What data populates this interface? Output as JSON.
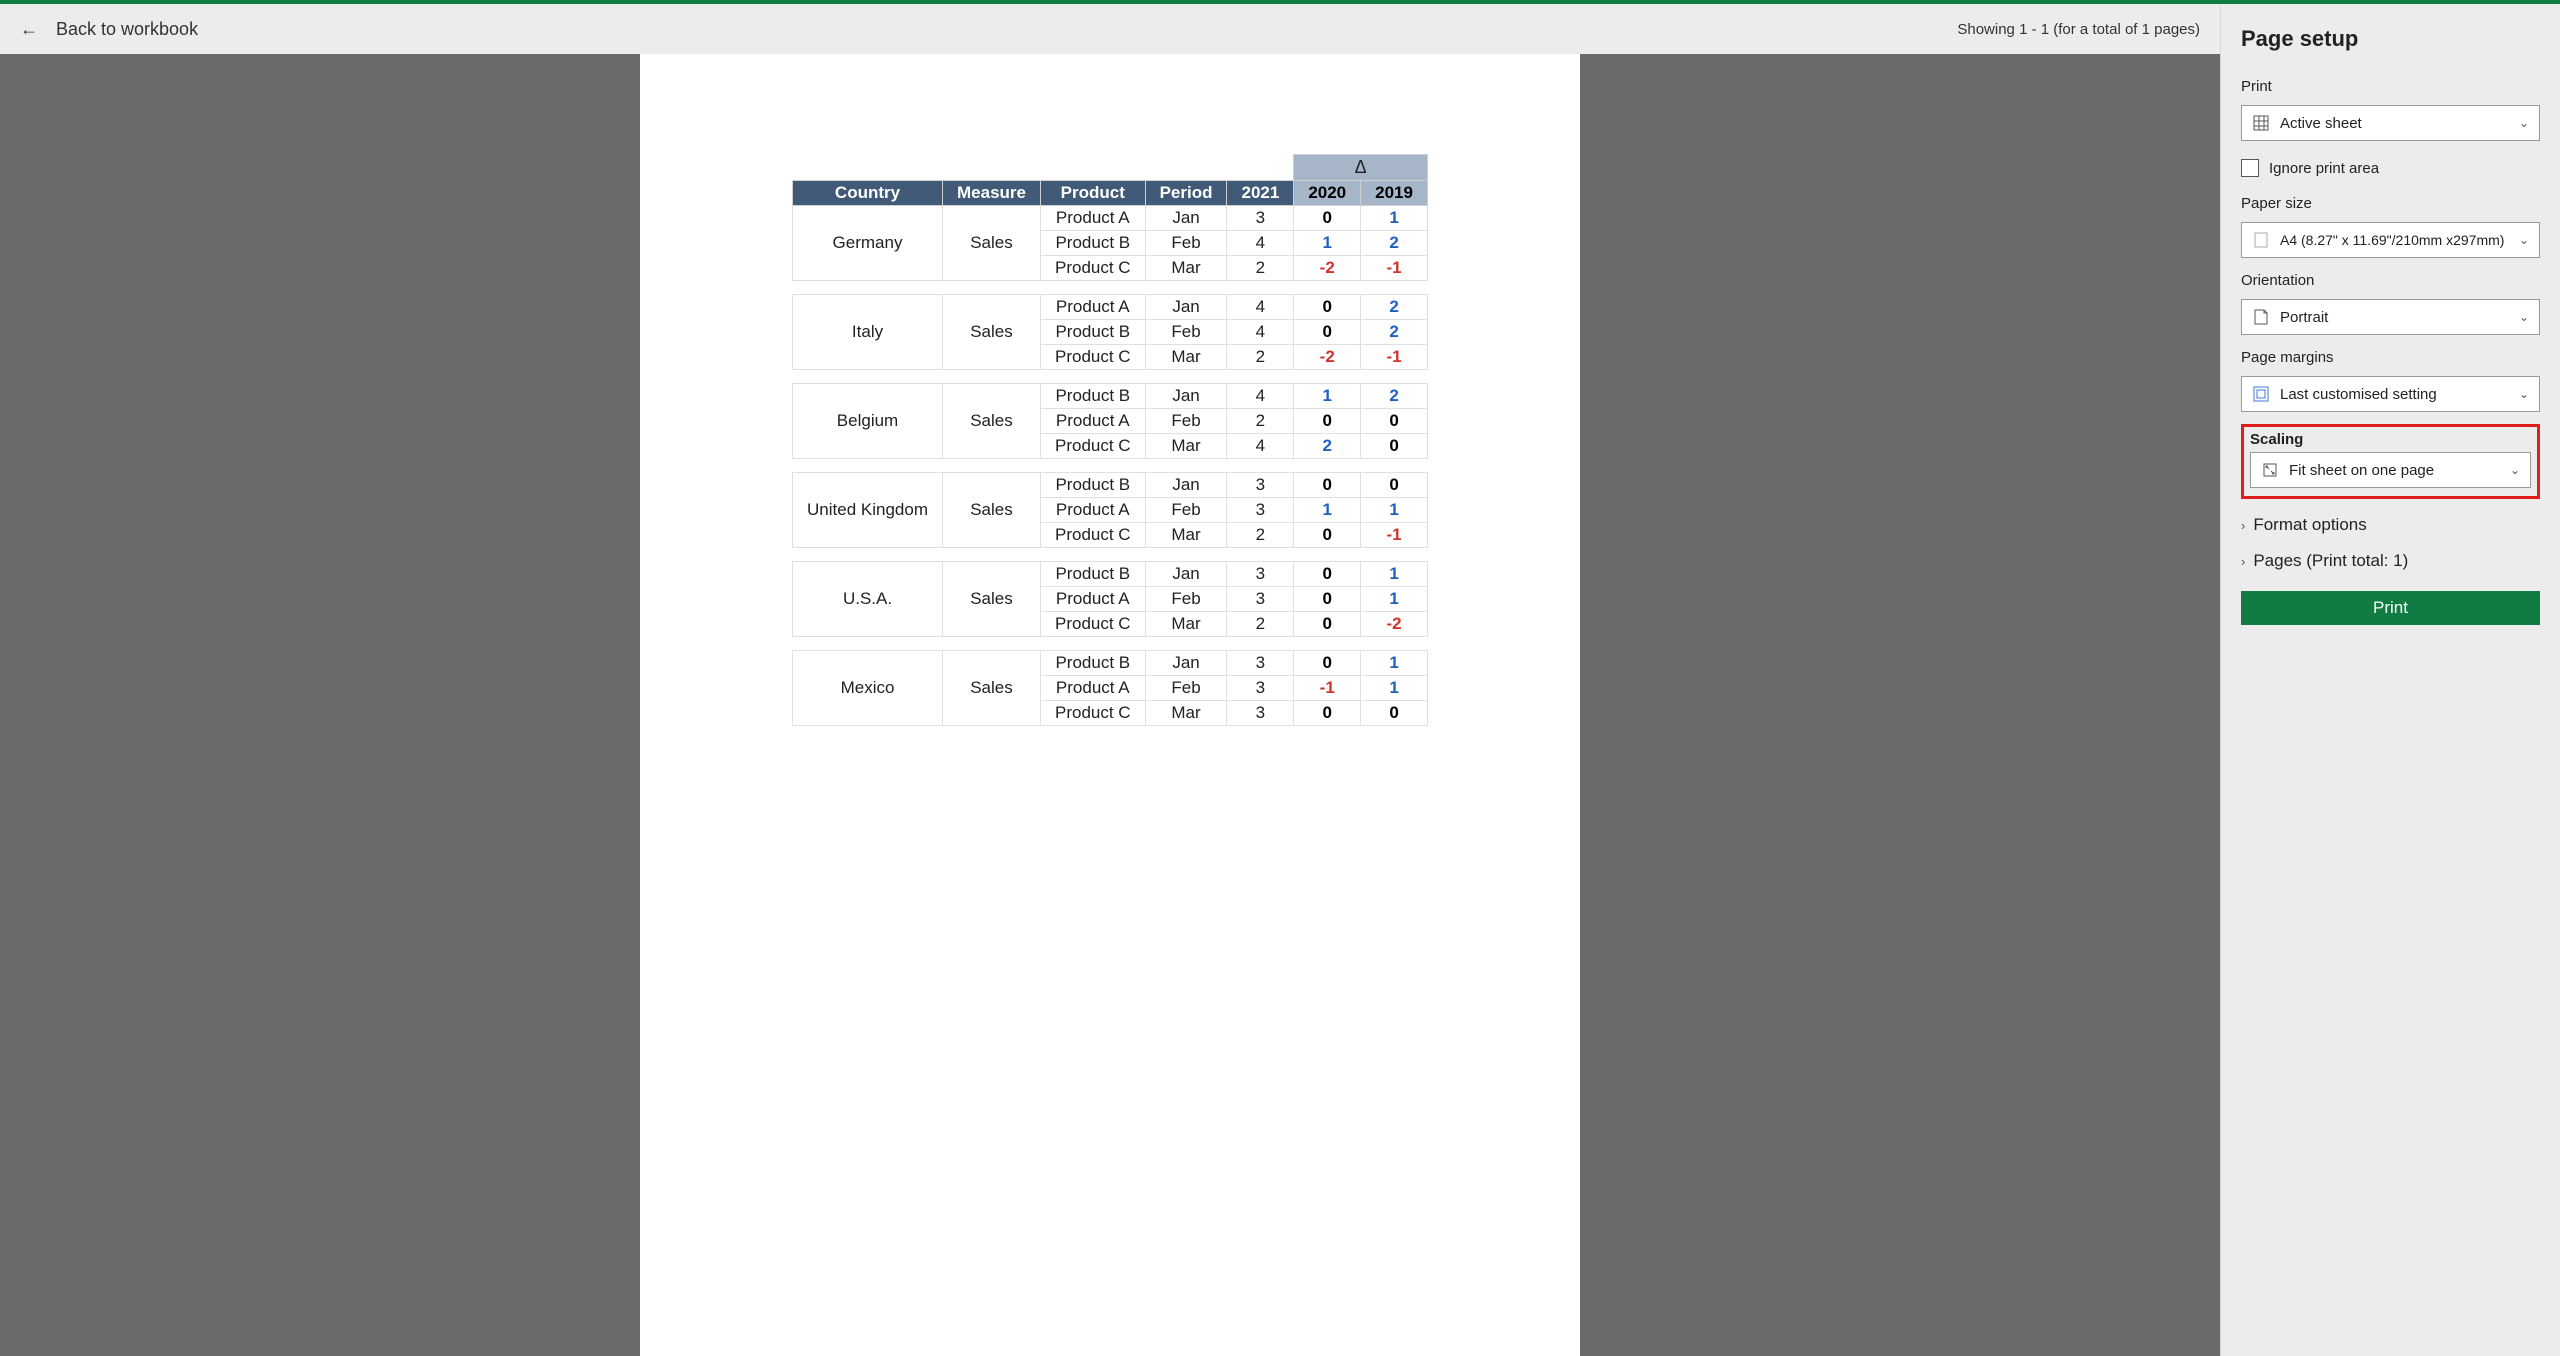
{
  "header": {
    "back_label": "Back to workbook",
    "status": "Showing 1 - 1 (for a total of 1 pages)"
  },
  "table": {
    "columns": [
      "Country",
      "Measure",
      "Product",
      "Period",
      "2021",
      "2020",
      "2019"
    ],
    "delta_symbol": "Δ",
    "groups": [
      {
        "country": "Germany",
        "measure": "Sales",
        "rows": [
          {
            "product": "Product A",
            "period": "Jan",
            "y2021": "3",
            "y2020": "0",
            "y2019": "1",
            "c20": "black",
            "c19": "blue"
          },
          {
            "product": "Product B",
            "period": "Feb",
            "y2021": "4",
            "y2020": "1",
            "y2019": "2",
            "c20": "blue",
            "c19": "blue"
          },
          {
            "product": "Product C",
            "period": "Mar",
            "y2021": "2",
            "y2020": "-2",
            "y2019": "-1",
            "c20": "red",
            "c19": "red"
          }
        ]
      },
      {
        "country": "Italy",
        "measure": "Sales",
        "rows": [
          {
            "product": "Product A",
            "period": "Jan",
            "y2021": "4",
            "y2020": "0",
            "y2019": "2",
            "c20": "black",
            "c19": "blue"
          },
          {
            "product": "Product B",
            "period": "Feb",
            "y2021": "4",
            "y2020": "0",
            "y2019": "2",
            "c20": "black",
            "c19": "blue"
          },
          {
            "product": "Product C",
            "period": "Mar",
            "y2021": "2",
            "y2020": "-2",
            "y2019": "-1",
            "c20": "red",
            "c19": "red"
          }
        ]
      },
      {
        "country": "Belgium",
        "measure": "Sales",
        "rows": [
          {
            "product": "Product B",
            "period": "Jan",
            "y2021": "4",
            "y2020": "1",
            "y2019": "2",
            "c20": "blue",
            "c19": "blue"
          },
          {
            "product": "Product A",
            "period": "Feb",
            "y2021": "2",
            "y2020": "0",
            "y2019": "0",
            "c20": "black",
            "c19": "black"
          },
          {
            "product": "Product C",
            "period": "Mar",
            "y2021": "4",
            "y2020": "2",
            "y2019": "0",
            "c20": "blue",
            "c19": "black"
          }
        ]
      },
      {
        "country": "United Kingdom",
        "measure": "Sales",
        "rows": [
          {
            "product": "Product B",
            "period": "Jan",
            "y2021": "3",
            "y2020": "0",
            "y2019": "0",
            "c20": "black",
            "c19": "black"
          },
          {
            "product": "Product A",
            "period": "Feb",
            "y2021": "3",
            "y2020": "1",
            "y2019": "1",
            "c20": "blue",
            "c19": "blue"
          },
          {
            "product": "Product C",
            "period": "Mar",
            "y2021": "2",
            "y2020": "0",
            "y2019": "-1",
            "c20": "black",
            "c19": "red"
          }
        ]
      },
      {
        "country": "U.S.A.",
        "measure": "Sales",
        "rows": [
          {
            "product": "Product B",
            "period": "Jan",
            "y2021": "3",
            "y2020": "0",
            "y2019": "1",
            "c20": "black",
            "c19": "blue"
          },
          {
            "product": "Product A",
            "period": "Feb",
            "y2021": "3",
            "y2020": "0",
            "y2019": "1",
            "c20": "black",
            "c19": "blue"
          },
          {
            "product": "Product C",
            "period": "Mar",
            "y2021": "2",
            "y2020": "0",
            "y2019": "-2",
            "c20": "black",
            "c19": "red"
          }
        ]
      },
      {
        "country": "Mexico",
        "measure": "Sales",
        "rows": [
          {
            "product": "Product B",
            "period": "Jan",
            "y2021": "3",
            "y2020": "0",
            "y2019": "1",
            "c20": "black",
            "c19": "blue"
          },
          {
            "product": "Product A",
            "period": "Feb",
            "y2021": "3",
            "y2020": "-1",
            "y2019": "1",
            "c20": "red",
            "c19": "blue"
          },
          {
            "product": "Product C",
            "period": "Mar",
            "y2021": "3",
            "y2020": "0",
            "y2019": "0",
            "c20": "black",
            "c19": "black"
          }
        ]
      }
    ]
  },
  "panel": {
    "title": "Page setup",
    "print_label": "Print",
    "print_value": "Active sheet",
    "ignore_print_area": "Ignore print area",
    "paper_size_label": "Paper size",
    "paper_size_value": "A4 (8.27\" x 11.69\"/210mm x297mm)",
    "orientation_label": "Orientation",
    "orientation_value": "Portrait",
    "margins_label": "Page margins",
    "margins_value": "Last customised setting",
    "scaling_label": "Scaling",
    "scaling_value": "Fit sheet on one page",
    "format_options": "Format options",
    "pages_label": "Pages (Print total: 1)",
    "print_button": "Print"
  }
}
